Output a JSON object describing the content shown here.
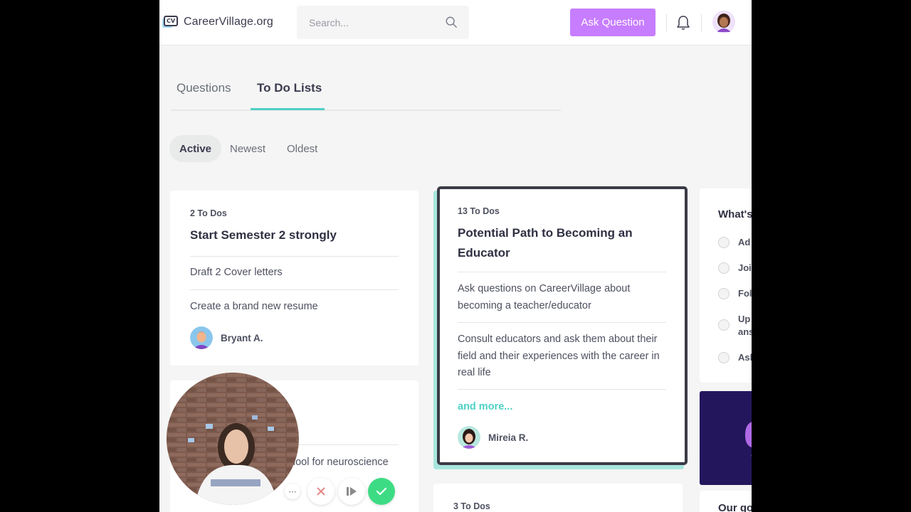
{
  "header": {
    "logo_badge": "CV",
    "logo_text": "CareerVillage.org",
    "search_placeholder": "Search...",
    "ask_button": "Ask Question"
  },
  "tabs": [
    {
      "label": "Questions",
      "active": false
    },
    {
      "label": "To Do Lists",
      "active": true
    }
  ],
  "filters": [
    {
      "label": "Active",
      "active": true
    },
    {
      "label": "Newest",
      "active": false
    },
    {
      "label": "Oldest",
      "active": false
    }
  ],
  "cards": [
    {
      "count": "2 To Dos",
      "title": "Start Semester 2 strongly",
      "items": [
        "Draft 2 Cover letters",
        "Create a brand new resume"
      ],
      "user": "Bryant A."
    },
    {
      "count": "13 To Dos",
      "title": "Potential Path to Becoming an Educator",
      "items": [
        "Ask questions on CareerVillage about becoming a teacher/educator",
        "Consult educators and ask them about their field and their experiences with the career in real life"
      ],
      "more": "and more...",
      "user": "Mireia R.",
      "selected": true
    },
    {
      "partial_item": "hool for neuroscience"
    },
    {
      "count": "3 To Dos"
    }
  ],
  "right_panel": {
    "title": "What's",
    "options": [
      "Ad",
      "Joi",
      "Fol",
      "Up",
      "ans",
      "Asl"
    ],
    "bottom_title": "Our go"
  },
  "colors": {
    "accent": "#4fd1c5",
    "brand_purple": "#c77dff",
    "dark_navy": "#24165c"
  }
}
